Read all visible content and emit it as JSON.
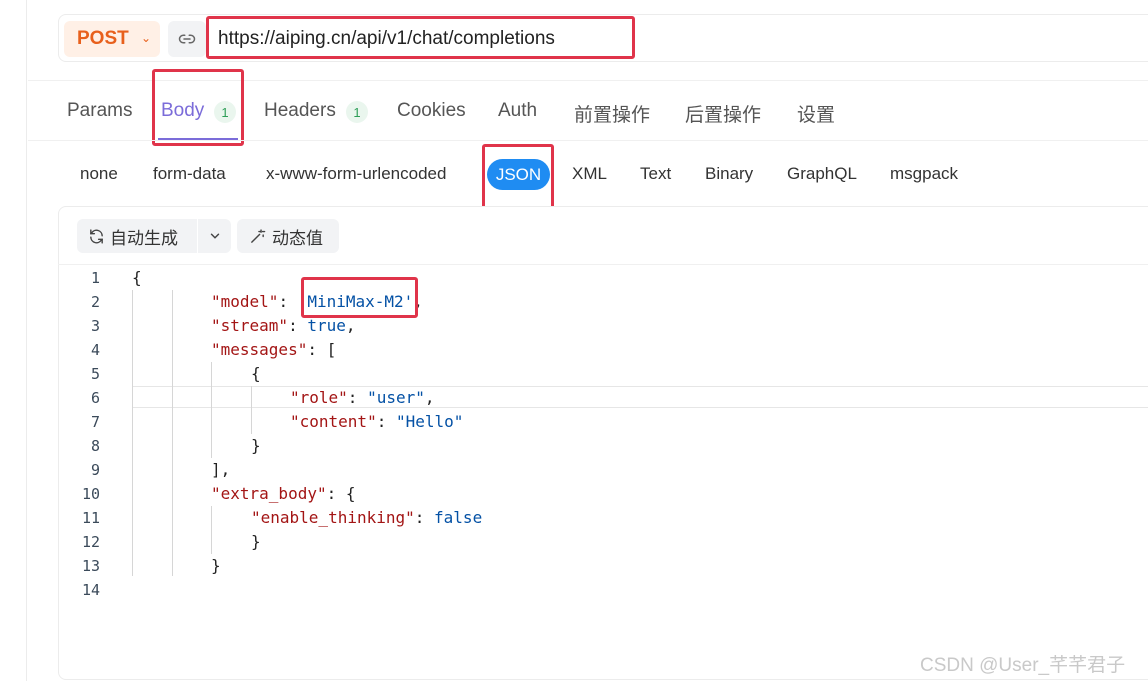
{
  "request": {
    "method": "POST",
    "url": "https://aiping.cn/api/v1/chat/completions"
  },
  "tabs": [
    {
      "label": "Params"
    },
    {
      "label": "Body",
      "badge": "1",
      "active": true
    },
    {
      "label": "Headers",
      "badge": "1"
    },
    {
      "label": "Cookies"
    },
    {
      "label": "Auth"
    },
    {
      "label": "前置操作"
    },
    {
      "label": "后置操作"
    },
    {
      "label": "设置"
    }
  ],
  "body_types": [
    "none",
    "form-data",
    "x-www-form-urlencoded",
    "JSON",
    "XML",
    "Text",
    "Binary",
    "GraphQL",
    "msgpack"
  ],
  "body_type_selected": "JSON",
  "toolbar": {
    "auto_generate": "自动生成",
    "dynamic_value": "动态值"
  },
  "code": {
    "line_numbers": [
      "1",
      "2",
      "3",
      "4",
      "5",
      "6",
      "7",
      "8",
      "9",
      "10",
      "11",
      "12",
      "13",
      "14"
    ],
    "l1": "{",
    "model_key": "\"model\"",
    "model_val": "'MiniMax-M2'",
    "stream_key": "\"stream\"",
    "stream_val": "true",
    "messages_key": "\"messages\"",
    "role_key": "\"role\"",
    "role_val": "\"user\"",
    "content_key": "\"content\"",
    "content_val": "\"Hello\"",
    "extra_key": "\"extra_body\"",
    "thinking_key": "\"enable_thinking\"",
    "thinking_val": "false"
  },
  "watermark": "CSDN @User_芊芊君子",
  "colors": {
    "method": "#e8601c",
    "active_tab": "#7b6cd9",
    "badge": "#2e9e57",
    "pill": "#1f8cf2",
    "highlight": "#e0344a"
  }
}
